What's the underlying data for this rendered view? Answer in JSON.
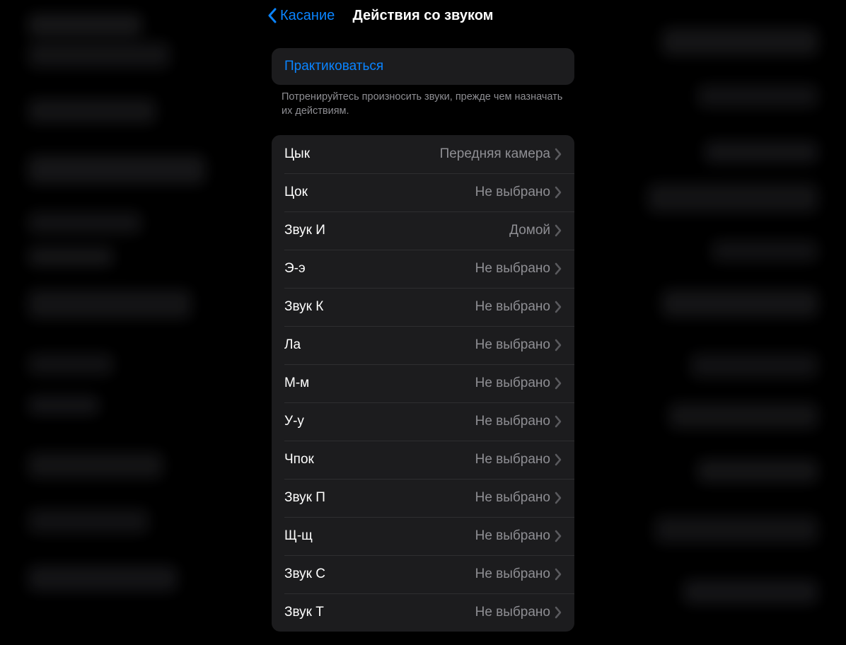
{
  "nav": {
    "back_label": "Касание",
    "title": "Действия со звуком"
  },
  "practice": {
    "label": "Практиковаться",
    "footer": "Потренируйтесь произносить звуки, прежде чем назначать их действиям."
  },
  "sounds": [
    {
      "name": "Цык",
      "value": "Передняя камера"
    },
    {
      "name": "Цок",
      "value": "Не выбрано"
    },
    {
      "name": "Звук И",
      "value": "Домой"
    },
    {
      "name": "Э-э",
      "value": "Не выбрано"
    },
    {
      "name": "Звук К",
      "value": "Не выбрано"
    },
    {
      "name": "Ла",
      "value": "Не выбрано"
    },
    {
      "name": "М-м",
      "value": "Не выбрано"
    },
    {
      "name": "У-у",
      "value": "Не выбрано"
    },
    {
      "name": "Чпок",
      "value": "Не выбрано"
    },
    {
      "name": "Звук П",
      "value": "Не выбрано"
    },
    {
      "name": "Щ-щ",
      "value": "Не выбрано"
    },
    {
      "name": "Звук С",
      "value": "Не выбрано"
    },
    {
      "name": "Звук Т",
      "value": "Не выбрано"
    }
  ]
}
